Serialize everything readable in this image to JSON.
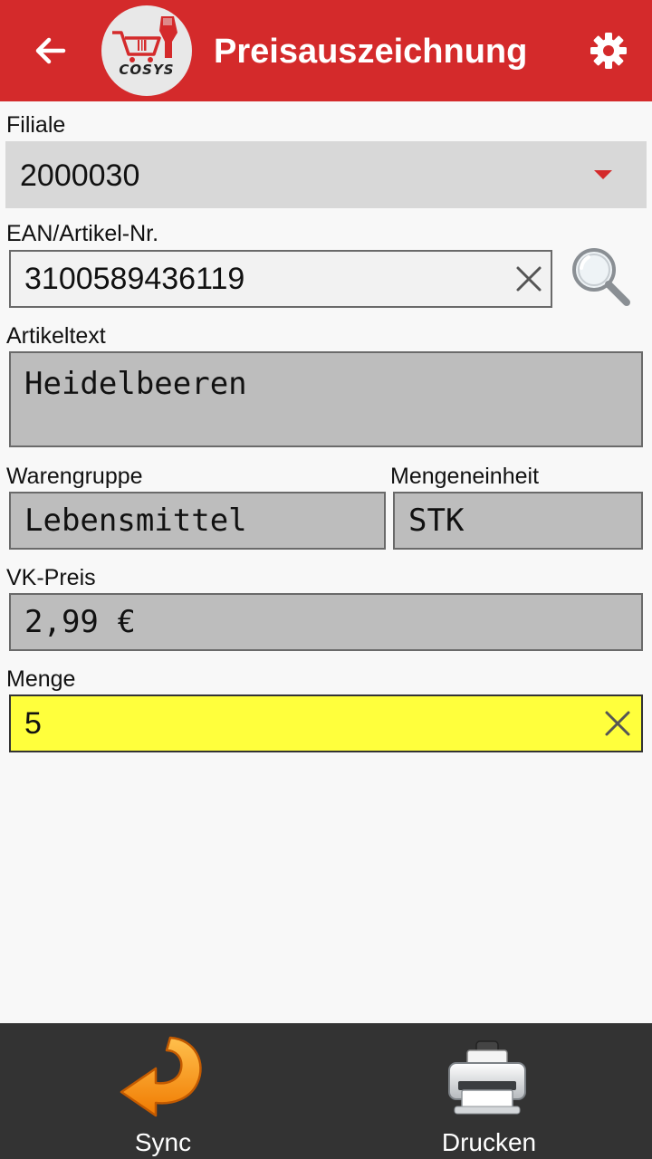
{
  "header": {
    "title": "Preisauszeichnung",
    "logo_text": "COSYS",
    "back_icon": "arrow-back-icon",
    "settings_icon": "gear-icon",
    "color": "#d42a2b"
  },
  "form": {
    "filiale": {
      "label": "Filiale",
      "value": "2000030"
    },
    "ean": {
      "label": "EAN/Artikel-Nr.",
      "value": "3100589436119"
    },
    "artikeltext": {
      "label": "Artikeltext",
      "value": "Heidelbeeren"
    },
    "warengruppe": {
      "label": "Warengruppe",
      "value": "Lebensmittel"
    },
    "mengeneinheit": {
      "label": "Mengeneinheit",
      "value": "STK"
    },
    "vk_preis": {
      "label": "VK-Preis",
      "value": "2,99 €"
    },
    "menge": {
      "label": "Menge",
      "value": "5",
      "highlight_color": "#ffff3c"
    }
  },
  "bottom_bar": {
    "sync_label": "Sync",
    "print_label": "Drucken"
  }
}
